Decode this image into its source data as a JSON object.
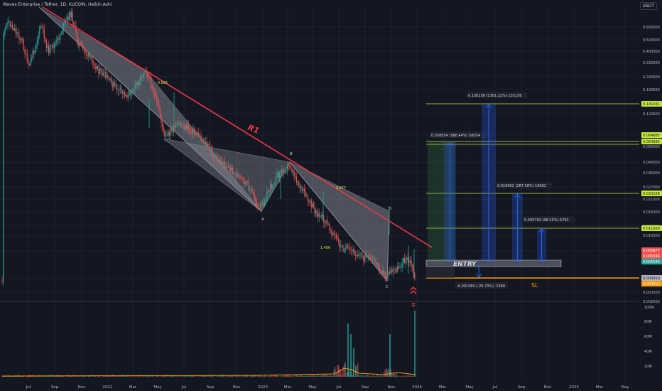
{
  "header": {
    "title": "Waves Enterprise / Tether, 1D, KUCOIN, Heikin Ashi",
    "currency": "USDT"
  },
  "colors": {
    "background": "#131722",
    "up": "#26a69a",
    "down": "#ef5350",
    "resistance": "#f23645",
    "pattern_fill": "#9598a1",
    "target": "#c8e63c",
    "stop": "#ff9800",
    "projection": "#2962ff"
  },
  "chart_data": {
    "type": "candlestick",
    "scale": "log",
    "x_ticks": [
      "Jul",
      "Sep",
      "Nov",
      "2022",
      "Mar",
      "May",
      "Jul",
      "Sep",
      "Nov",
      "2023",
      "Mar",
      "May",
      "Jul",
      "Sep",
      "Nov",
      "2024",
      "Mar",
      "May",
      "Jul",
      "Sep",
      "Nov",
      "2025",
      "Mar",
      "May"
    ],
    "y_ticks": [
      "0.650000",
      "0.500000",
      "0.400000",
      "0.320000",
      "0.240000",
      "0.190000",
      "0.120000",
      "0.090000",
      "0.060000",
      "0.045000",
      "0.035000",
      "0.027000",
      "0.021000",
      "0.016000",
      "0.012000",
      "0.010000",
      "0.006000",
      "0.004000",
      "0.003200",
      "0.002500"
    ],
    "volume_ticks": [
      "100M",
      "80M",
      "60M",
      "40M",
      "20M"
    ],
    "price_badges": [
      {
        "label": "0.141031",
        "color": "#c8e63c"
      },
      {
        "label": "0.064685",
        "color": "#c8e63c"
      },
      {
        "label": "0.064685",
        "color": "#c8e63c"
      },
      {
        "label": "0.023158",
        "color": "#c8e63c"
      },
      {
        "label": "0.011669",
        "color": "#c8e63c"
      },
      {
        "label": "0.005877",
        "color": "#ef5350"
      },
      {
        "label": "0.005596",
        "color": "#ef5350"
      },
      {
        "label": "0.005546",
        "color": "#26a69a"
      },
      {
        "label": "0.004310",
        "color": "#b2b5be"
      },
      {
        "label": "0.004310",
        "color": "#ff9800"
      }
    ],
    "annotations": {
      "resistance_label": "R1",
      "pattern_points": [
        "A",
        "B",
        "C",
        "D"
      ],
      "ratios": [
        "0.625",
        "0.877",
        "1.406"
      ],
      "entry_label": "ENTRY",
      "stop_label": "SL",
      "stop_measure": "-0.001580 (-26.73%) -1580"
    },
    "targets": [
      {
        "label": "0.058054 (988.44%) 58054",
        "level": 0.0647
      },
      {
        "label": "0.135158 (2301.22%) 135158",
        "level": 0.141
      },
      {
        "label": "0.016902 (287.58%) 16902",
        "level": 0.0232
      },
      {
        "label": "0.005792 (98.55%) 5792",
        "level": 0.01167
      }
    ]
  }
}
